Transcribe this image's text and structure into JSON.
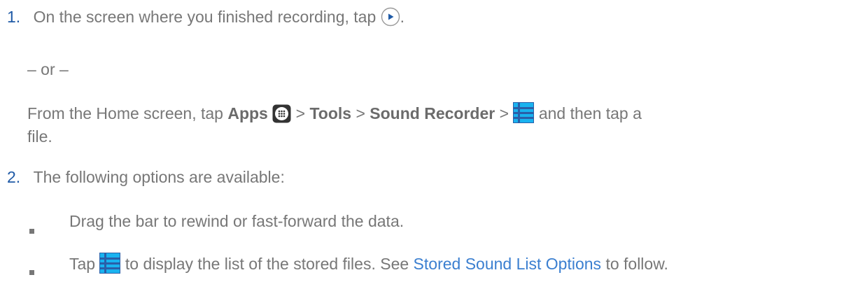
{
  "colors": {
    "text": "#777777",
    "accent": "#1f5aa6",
    "link": "#3b7fd0"
  },
  "step1": {
    "number": "1.",
    "text_a": "On the screen where you finished recording, tap",
    "text_b": ".",
    "play_icon": "play-circle-icon"
  },
  "or_text": "– or –",
  "alt": {
    "t1": "From the Home screen, tap",
    "apps": "Apps",
    "apps_icon": "apps-grid-icon",
    "sep1": ">",
    "tools": "Tools",
    "sep2": ">",
    "sound_recorder": "Sound Recorder",
    "sep3": ">",
    "list_icon": "list-icon",
    "t2": "and then tap a",
    "t3": "file."
  },
  "step2": {
    "number": "2.",
    "text": "The following options are available:",
    "bullets": [
      {
        "text": "Drag the bar to rewind or fast-forward the data."
      },
      {
        "prefix": "Tap",
        "list_icon": "list-icon",
        "middle": "to display the list of the stored files. See",
        "link": "Stored Sound List Options",
        "suffix": "to follow."
      }
    ]
  }
}
